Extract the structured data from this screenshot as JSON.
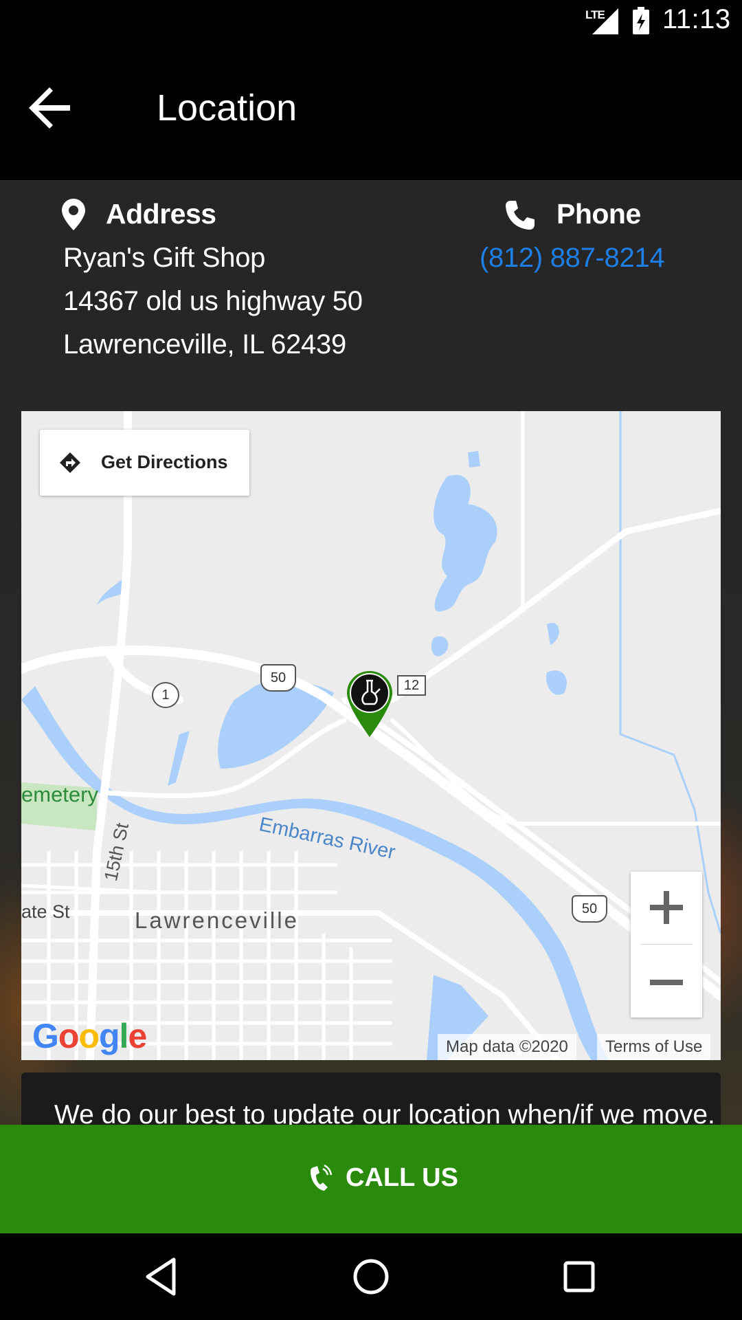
{
  "status_bar": {
    "network": "LTE",
    "time": "11:13",
    "icons": [
      "lte-signal-icon",
      "battery-charging-icon"
    ]
  },
  "app_bar": {
    "title": "Location",
    "back_icon": "arrow-left-icon"
  },
  "address": {
    "heading": "Address",
    "icon": "map-pin-icon",
    "lines": [
      "Ryan's Gift Shop",
      "14367 old us highway 50",
      "Lawrenceville, IL 62439"
    ]
  },
  "phone": {
    "heading": "Phone",
    "icon": "phone-icon",
    "number": "(812) 887-8214",
    "link_color": "#1e7fe6"
  },
  "map": {
    "directions_label": "Get Directions",
    "directions_icon": "directions-diamond-icon",
    "labels": {
      "cemetery": "emetery",
      "river": "Embarras River",
      "street": "15th St",
      "side_street": "ate St",
      "city": "Lawrenceville"
    },
    "route_shields": {
      "us50_a": "50",
      "us50_b": "50",
      "route1": "1",
      "route12": "12"
    },
    "zoom_in_label": "+",
    "zoom_out_label": "−",
    "logo": "Google",
    "map_data": "Map data ©2020",
    "terms": "Terms of Use",
    "marker_icon": "store-marker-icon",
    "colors": {
      "water": "#a9cffa",
      "road": "#ffffff",
      "land": "#ececec",
      "park": "#c8e6c0",
      "marker": "#2a8a0c"
    }
  },
  "note": {
    "text": "We do our best to update our location when/if we move."
  },
  "call_bar": {
    "label": "CALL US",
    "icon": "phone-ringing-icon",
    "color": "#2a8a0c"
  },
  "nav_bar": {
    "icons": [
      "back-triangle-icon",
      "home-circle-icon",
      "recents-square-icon"
    ]
  }
}
